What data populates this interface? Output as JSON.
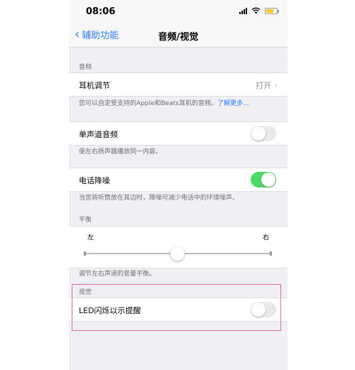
{
  "status_bar": {
    "time": "08:06"
  },
  "nav": {
    "back_label": "辅助功能",
    "title": "音频/视觉"
  },
  "audio_section": {
    "header": "音频",
    "headphone": {
      "label": "耳机调节",
      "value": "打开"
    },
    "headphone_footer": "您可以自定受支持的Apple和Beats耳机的音频。",
    "headphone_link": "了解更多...",
    "mono": {
      "label": "单声道音频",
      "on": false
    },
    "mono_footer": "使左右扬声器播放同一内容。",
    "noise": {
      "label": "电话降噪",
      "on": true
    },
    "noise_footer": "当您将听筒放在耳边时，降噪可减少电话中的环境噪声。"
  },
  "balance_section": {
    "header": "平衡",
    "left_label": "左",
    "right_label": "右",
    "balance_value": 0.5,
    "footer": "调节左右声道的音量平衡。"
  },
  "visual_section": {
    "header": "视觉",
    "led": {
      "label": "LED闪烁以示提醒",
      "on": false
    }
  },
  "colors": {
    "accent": "#2f7df6",
    "toggle_on": "#4cd964",
    "highlight": "#e06b96"
  }
}
